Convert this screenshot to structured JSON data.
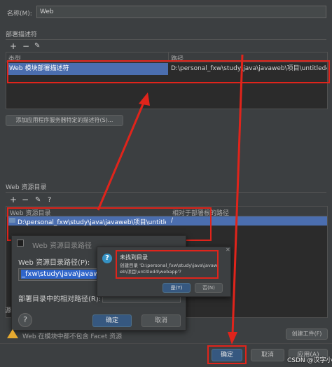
{
  "name_row": {
    "label": "名称(M):",
    "value": "Web"
  },
  "descriptors": {
    "section_title": "部署描述符",
    "columns": [
      "类型",
      "路径"
    ],
    "row": {
      "type": "Web 模块部署描述符",
      "path": "D:\\personal_fxw\\study\\java\\javaweb\\项目\\untitled4\\web\\W"
    },
    "add_button": "添加应用程序服务器特定的描述符(S)..."
  },
  "resources": {
    "section_title": "Web 资源目录",
    "columns": [
      "Web 资源目录",
      "相对于部署根的路径"
    ],
    "row": {
      "dir": "D:\\personal_fxw\\study\\java\\javaweb\\项目\\untitled4\\web",
      "rel": "/"
    }
  },
  "toolbar": {
    "add": "+",
    "remove": "−",
    "edit": "✎",
    "help": "?"
  },
  "resource_dialog": {
    "title": "Web 资源目录路径",
    "path_label": "Web 资源目录路径(P):",
    "path_value": "_fxw\\study\\java\\javaweb",
    "rel_label": "部署目录中的相对路径(R):",
    "ok": "确定",
    "cancel": "取消",
    "help": "?"
  },
  "confirm_dialog": {
    "title": "未找到目录",
    "message": "创建目录 'D:\\personal_fxw\\study\\java\\javaweb\\项目\\untitled4\\webapp'?",
    "yes": "是(Y)",
    "no": "否(N)"
  },
  "warning": {
    "text": "Web 在模块中都不包含 Facet 资源",
    "fix_button": "创建工件(F)"
  },
  "footer": {
    "ok": "确定",
    "cancel": "取消",
    "apply": "应用(A)"
  },
  "watermark": "CSDN @汉字小久",
  "colors": {
    "accent": "#4b6eaf",
    "highlight": "#e0241b",
    "primary_button": "#365880"
  }
}
